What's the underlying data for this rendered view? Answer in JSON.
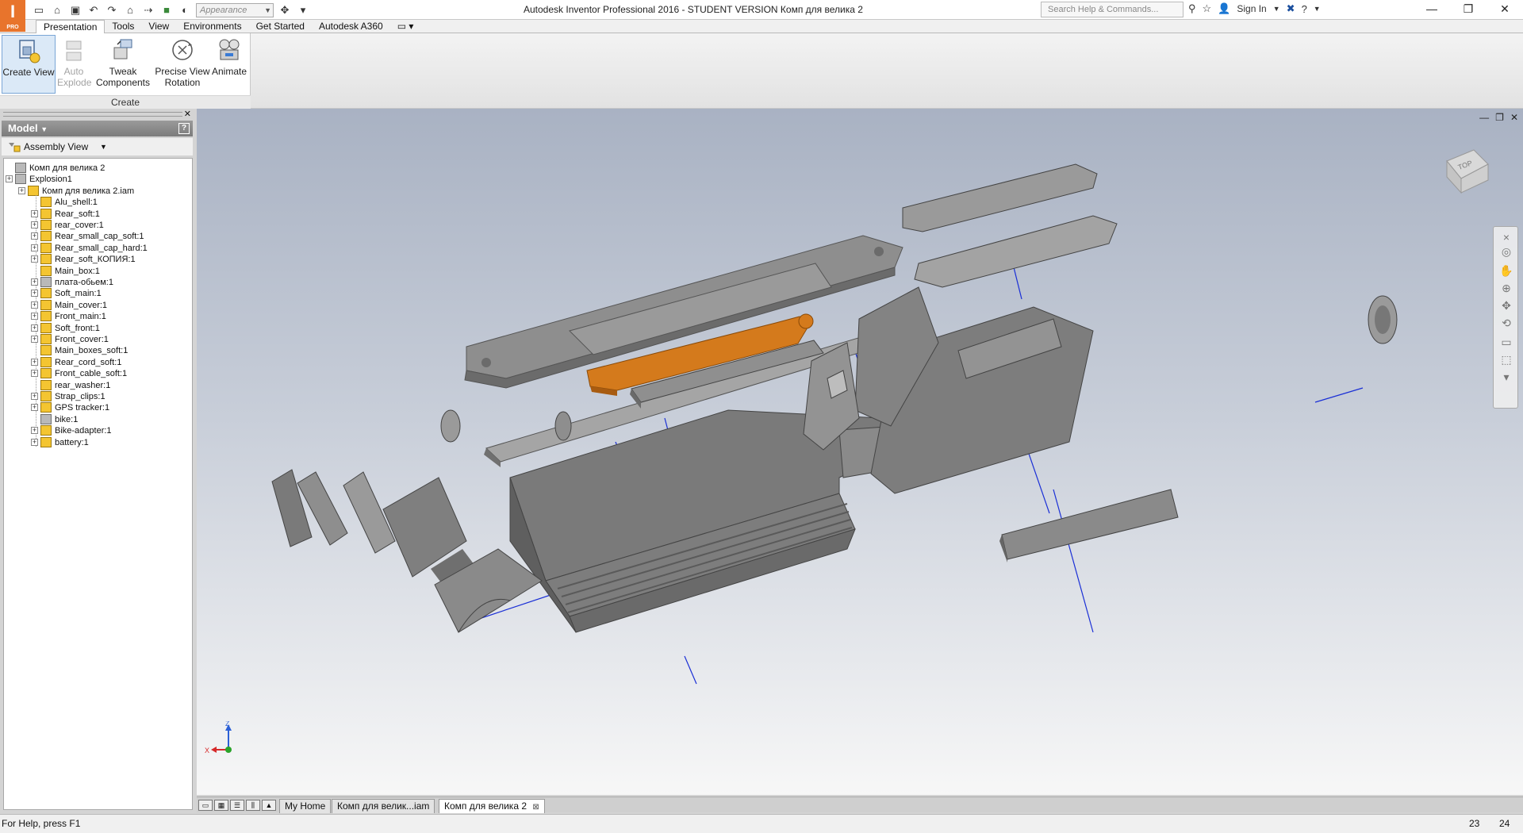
{
  "app": {
    "logo_letter": "I",
    "logo_sub": "PRO",
    "window_title": "Autodesk Inventor Professional 2016 - STUDENT VERSION    Комп для велика 2"
  },
  "quick_access": {
    "appearance_placeholder": "Appearance"
  },
  "help": {
    "search_placeholder": "Search Help & Commands...",
    "sign_in": "Sign In"
  },
  "ribbon": {
    "tabs": [
      "Presentation",
      "Tools",
      "View",
      "Environments",
      "Get Started",
      "Autodesk A360"
    ],
    "active_tab": "Presentation",
    "panel_label": "Create",
    "buttons": [
      {
        "line1": "Create View",
        "line2": "",
        "state": "active"
      },
      {
        "line1": "Auto",
        "line2": "Explode",
        "state": "disabled"
      },
      {
        "line1": "Tweak",
        "line2": "Components",
        "state": "normal"
      },
      {
        "line1": "Precise View",
        "line2": "Rotation",
        "state": "normal"
      },
      {
        "line1": "Animate",
        "line2": "",
        "state": "normal"
      }
    ]
  },
  "browser": {
    "header": "Model",
    "view_mode": "Assembly View",
    "root": "Комп для велика 2",
    "explosion": "Explosion1",
    "assembly": "Комп для велика 2.iam",
    "parts": [
      {
        "label": "Alu_shell:1",
        "expandable": false,
        "grey": false
      },
      {
        "label": "Rear_soft:1",
        "expandable": true,
        "grey": false
      },
      {
        "label": "rear_cover:1",
        "expandable": true,
        "grey": false
      },
      {
        "label": "Rear_small_cap_soft:1",
        "expandable": true,
        "grey": false
      },
      {
        "label": "Rear_small_cap_hard:1",
        "expandable": true,
        "grey": false
      },
      {
        "label": "Rear_soft_КОПИЯ:1",
        "expandable": true,
        "grey": false
      },
      {
        "label": "Main_box:1",
        "expandable": false,
        "grey": false
      },
      {
        "label": "плата-обьем:1",
        "expandable": true,
        "grey": true
      },
      {
        "label": "Soft_main:1",
        "expandable": true,
        "grey": false
      },
      {
        "label": "Main_cover:1",
        "expandable": true,
        "grey": false
      },
      {
        "label": "Front_main:1",
        "expandable": true,
        "grey": false
      },
      {
        "label": "Soft_front:1",
        "expandable": true,
        "grey": false
      },
      {
        "label": "Front_cover:1",
        "expandable": true,
        "grey": false
      },
      {
        "label": "Main_boxes_soft:1",
        "expandable": false,
        "grey": false
      },
      {
        "label": "Rear_cord_soft:1",
        "expandable": true,
        "grey": false
      },
      {
        "label": "Front_cable_soft:1",
        "expandable": true,
        "grey": false
      },
      {
        "label": "rear_washer:1",
        "expandable": false,
        "grey": false
      },
      {
        "label": "Strap_clips:1",
        "expandable": true,
        "grey": false
      },
      {
        "label": "GPS tracker:1",
        "expandable": true,
        "grey": false
      },
      {
        "label": "bike:1",
        "expandable": false,
        "grey": true
      },
      {
        "label": "Bike-adapter:1",
        "expandable": true,
        "grey": false
      },
      {
        "label": "battery:1",
        "expandable": true,
        "grey": false
      }
    ]
  },
  "viewport": {
    "viewcube_face": "TOP",
    "axes": {
      "x": "X",
      "y": "Y",
      "z": "Z"
    },
    "highlight_color": "#d47a1c",
    "part_color": "#8c8c8c"
  },
  "doc_tabs": [
    {
      "label": "My Home",
      "active": false
    },
    {
      "label": "Комп для велик...iam",
      "active": false
    },
    {
      "label": "Комп для велика 2",
      "active": true
    }
  ],
  "status": {
    "help": "For Help, press F1",
    "count1": "23",
    "count2": "24"
  }
}
